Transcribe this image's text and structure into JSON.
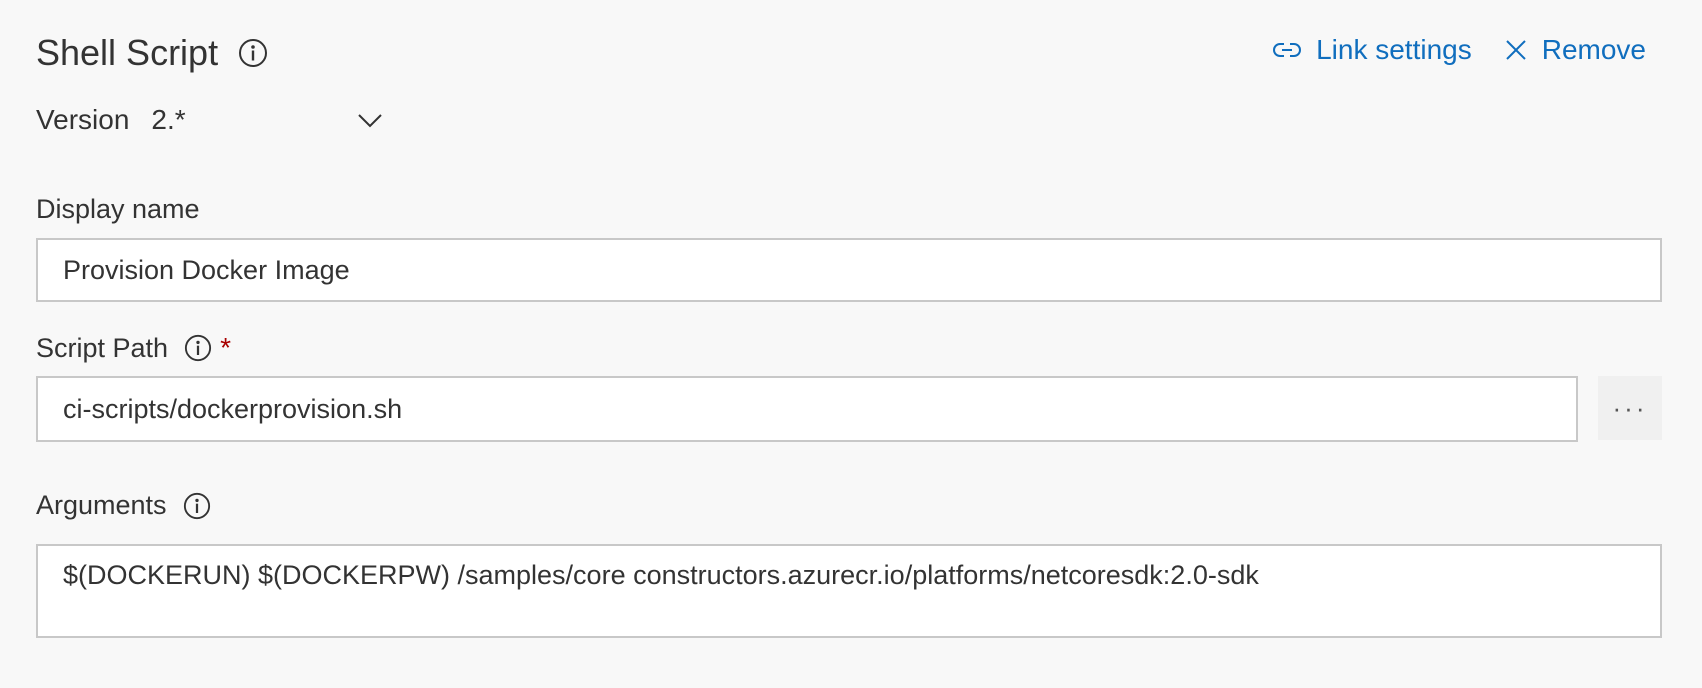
{
  "task": {
    "title": "Shell Script",
    "actions": {
      "link_settings_label": "Link settings",
      "remove_label": "Remove"
    },
    "version": {
      "label": "Version",
      "value": "2.*"
    }
  },
  "fields": {
    "display_name": {
      "label": "Display name",
      "value": "Provision Docker Image"
    },
    "script_path": {
      "label": "Script Path",
      "required_marker": "*",
      "value": "ci-scripts/dockerprovision.sh",
      "browse_label": "···"
    },
    "arguments": {
      "label": "Arguments",
      "value": "$(DOCKERUN) $(DOCKERPW) /samples/core constructors.azurecr.io/platforms/netcoresdk:2.0-sdk"
    }
  },
  "icons": {
    "info": "info-icon",
    "link": "link-icon",
    "remove": "close-icon",
    "dropdown": "chevron-down-icon"
  },
  "colors": {
    "accent": "#106ebe",
    "required": "#a80000",
    "background": "#f8f8f8",
    "border": "#c8c8c8"
  }
}
